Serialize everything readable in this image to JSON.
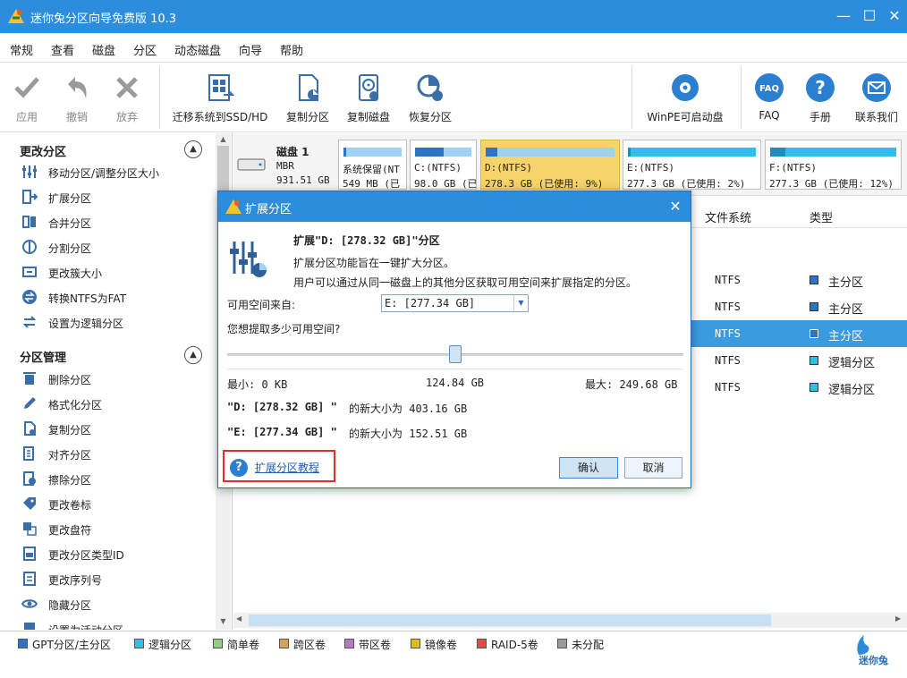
{
  "window": {
    "title": "迷你兔分区向导免费版 10.3",
    "accent": "#2b8ddb"
  },
  "menu": [
    "常规",
    "查看",
    "磁盘",
    "分区",
    "动态磁盘",
    "向导",
    "帮助"
  ],
  "toolbar": {
    "apply": "应用",
    "undo": "撤销",
    "discard": "放弃",
    "migrate": "迁移系统到SSD/HD",
    "copy_partition": "复制分区",
    "copy_disk": "复制磁盘",
    "recover": "恢复分区",
    "winpe": "WinPE可启动盘",
    "faq": "FAQ",
    "manual": "手册",
    "contact": "联系我们"
  },
  "sidebar": {
    "section1": {
      "title": "更改分区",
      "items": [
        "移动分区/调整分区大小",
        "扩展分区",
        "合并分区",
        "分割分区",
        "更改簇大小",
        "转换NTFS为FAT",
        "设置为逻辑分区"
      ]
    },
    "section2": {
      "title": "分区管理",
      "items": [
        "删除分区",
        "格式化分区",
        "复制分区",
        "对齐分区",
        "擦除分区",
        "更改卷标",
        "更改盘符",
        "更改分区类型ID",
        "更改序列号",
        "隐藏分区",
        "设置为活动分区"
      ]
    }
  },
  "disk": {
    "name": "磁盘 1",
    "style": "MBR",
    "size": "931.51 GB",
    "partitions": [
      {
        "name": "系统保留(NT",
        "size": "549 MB (已",
        "used": 0.05
      },
      {
        "name": "C:(NTFS)",
        "size": "98.0 GB (已",
        "used": 0.5
      },
      {
        "name": "D:(NTFS)",
        "size": "278.3 GB (已使用: 9%)",
        "used": 0.09
      },
      {
        "name": "E:(NTFS)",
        "size": "277.3 GB (已使用: 2%)",
        "used": 0.02
      },
      {
        "name": "F:(NTFS)",
        "size": "277.3 GB (已使用: 12%)",
        "used": 0.12
      }
    ]
  },
  "table": {
    "headers": {
      "fs": "文件系统",
      "type": "类型"
    },
    "rows": [
      {
        "fs": "NTFS",
        "type": "主分区",
        "color": "#2f74c4"
      },
      {
        "fs": "NTFS",
        "type": "主分区",
        "color": "#2f74c4"
      },
      {
        "fs": "NTFS",
        "type": "主分区",
        "color": "#2f74c4"
      },
      {
        "fs": "NTFS",
        "type": "逻辑分区",
        "color": "#2ec0e8"
      },
      {
        "fs": "NTFS",
        "type": "逻辑分区",
        "color": "#2ec0e8"
      }
    ]
  },
  "legend": [
    {
      "label": "GPT分区/主分区",
      "color": "#2f74c4"
    },
    {
      "label": "逻辑分区",
      "color": "#2ec0e8"
    },
    {
      "label": "简单卷",
      "color": "#8fcf7f"
    },
    {
      "label": "跨区卷",
      "color": "#d6a35a"
    },
    {
      "label": "带区卷",
      "color": "#b67ac4"
    },
    {
      "label": "镜像卷",
      "color": "#d8c21a"
    },
    {
      "label": "RAID-5卷",
      "color": "#e5484d"
    },
    {
      "label": "未分配",
      "color": "#9a9a9a"
    }
  ],
  "brand": "迷你兔",
  "dialog": {
    "title": "扩展分区",
    "heading": "扩展\"D: [278.32 GB]\"分区",
    "desc1": "扩展分区功能旨在一键扩大分区。",
    "desc2": "用户可以通过从同一磁盘上的其他分区获取可用空间来扩展指定的分区。",
    "source_label": "可用空间来自:",
    "source_value": "E:  [277.34 GB]",
    "question": "您想提取多少可用空间?",
    "slider_value": 0.5,
    "min_label": "最小: 0 KB",
    "mid_label": "124.84 GB",
    "max_label": "最大:  249.68 GB",
    "d_prefix": "\"D: [278.32 GB] \"",
    "d_suffix": "的新大小为 403.16 GB",
    "e_prefix": "\"E: [277.34 GB] \"",
    "e_suffix": "的新大小为 152.51 GB",
    "tutorial": "扩展分区教程",
    "ok": "确认",
    "cancel": "取消"
  }
}
